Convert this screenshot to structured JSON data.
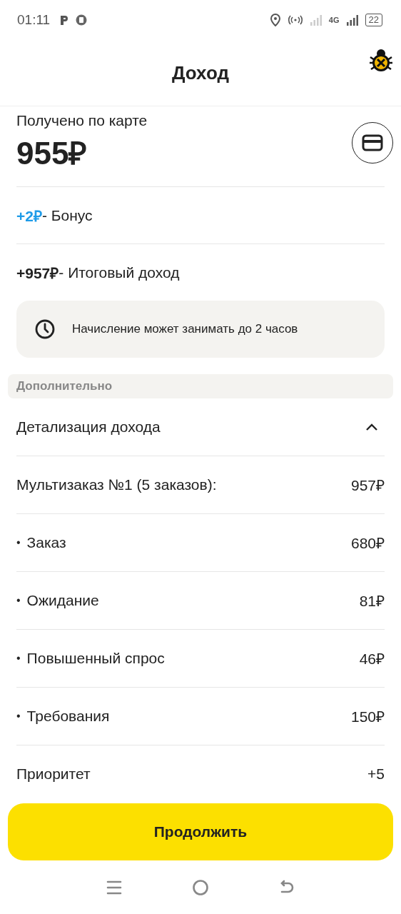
{
  "status_bar": {
    "time": "01:11",
    "network": "4G",
    "battery": "22"
  },
  "header": {
    "title": "Доход"
  },
  "card_payment": {
    "label": "Получено по карте",
    "amount": "955₽"
  },
  "bonus": {
    "amount": "+2₽",
    "label": "- Бонус"
  },
  "total": {
    "amount": "+957₽",
    "label": "- Итоговый доход"
  },
  "notice": {
    "text": "Начисление может занимать до 2 часов"
  },
  "section": {
    "title": "Дополнительно"
  },
  "details": {
    "title": "Детализация дохода",
    "expanded": true,
    "rows": [
      {
        "kind": "group",
        "label": "Мультизаказ №1 (5 заказов):",
        "value": "957₽"
      },
      {
        "kind": "item",
        "bullet": "•",
        "label": "Заказ",
        "value": "680₽"
      },
      {
        "kind": "item",
        "bullet": "•",
        "label": "Ожидание",
        "value": "81₽"
      },
      {
        "kind": "item",
        "bullet": "•",
        "label": "Повышенный спрос",
        "value": "46₽"
      },
      {
        "kind": "item",
        "bullet": "•",
        "label": "Требования",
        "value": "150₽"
      },
      {
        "kind": "group",
        "label": "Приоритет",
        "value": "+5"
      }
    ]
  },
  "button": {
    "label": "Продолжить"
  }
}
